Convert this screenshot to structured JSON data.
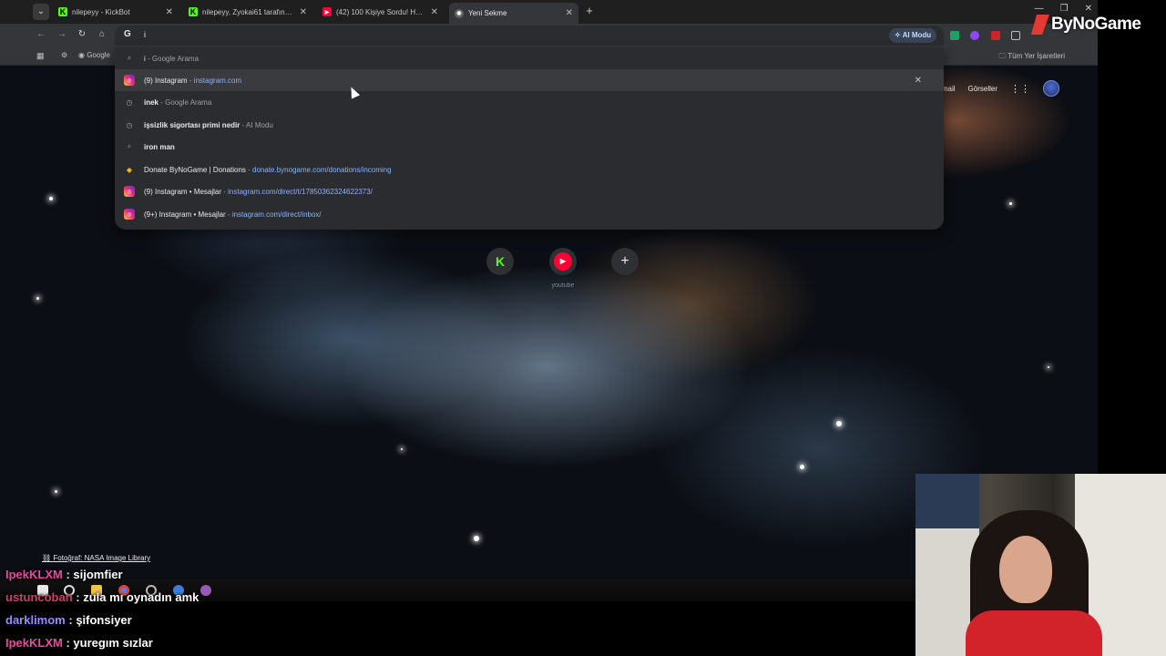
{
  "tabs": [
    {
      "title": "nilepeyy - KickBot",
      "active": false,
      "favicon": "kick-icon"
    },
    {
      "title": "nilepeyy, Zyokai61 tarafından i...",
      "active": false,
      "favicon": "kick-icon"
    },
    {
      "title": "(42) 100 Kişiye Sordu! Hangi ...",
      "active": false,
      "favicon": "youtube-icon"
    },
    {
      "title": "Yeni Sekme",
      "active": true,
      "favicon": "chrome-icon"
    }
  ],
  "omnibox": {
    "typed_text": "i",
    "ai_mode_label": "AI Modu"
  },
  "bookmarks": {
    "first_item": "Google",
    "all_bookmarks": "Tüm Yer İşaretleri"
  },
  "suggestions": [
    {
      "type": "search",
      "icon": "search-icon",
      "text": "i",
      "separator": " - ",
      "secondary": "Google Arama",
      "selected": false
    },
    {
      "type": "history-site",
      "icon": "instagram-icon",
      "text": "(9) Instagram",
      "separator": " - ",
      "secondary": "instagram.com",
      "selected": true
    },
    {
      "type": "history",
      "icon": "history-icon",
      "text": "inek",
      "separator": " - ",
      "secondary": "Google Arama",
      "selected": false
    },
    {
      "type": "history",
      "icon": "history-icon",
      "text": "işsizlik sigortası primi nedir",
      "separator": " - ",
      "secondary": "AI Modu",
      "selected": false
    },
    {
      "type": "search",
      "icon": "search-icon",
      "text": "iron man",
      "separator": "",
      "secondary": "",
      "selected": false
    },
    {
      "type": "site",
      "icon": "bynogame-icon",
      "text": "Donate ByNoGame | Donations",
      "separator": " - ",
      "secondary": "donate.bynogame.com/donations/incoming",
      "selected": false
    },
    {
      "type": "site",
      "icon": "instagram-icon",
      "text": "(9) Instagram • Mesajlar",
      "separator": " - ",
      "secondary": "instagram.com/direct/t/17850362324622373/",
      "selected": false
    },
    {
      "type": "site",
      "icon": "instagram-icon",
      "text": "(9+) Instagram • Mesajlar",
      "separator": " - ",
      "secondary": "instagram.com/direct/inbox/",
      "selected": false
    }
  ],
  "ntp": {
    "gmail": "Gmail",
    "images": "Görseller",
    "shortcuts": [
      {
        "label": "",
        "icon": "kick-icon"
      },
      {
        "label": "youtube",
        "icon": "youtube-icon"
      },
      {
        "label": "",
        "icon": "plus-icon"
      }
    ],
    "photo_credit": "Fotoğraf: NASA Image Library"
  },
  "overlay": {
    "logo_text": "ByNoGame",
    "chat": [
      {
        "user": "IpekKLXM",
        "user_color": "#e84aa0",
        "message": "sijomfier"
      },
      {
        "user": "ustuncoban",
        "user_color": "#d43b6b",
        "message": "zula mı oynadın amk"
      },
      {
        "user": "darklimom",
        "user_color": "#9a8cff",
        "message": "şifonsiyer"
      },
      {
        "user": "IpekKLXM",
        "user_color": "#e84aa0",
        "message": "yuregım sızlar"
      }
    ]
  }
}
